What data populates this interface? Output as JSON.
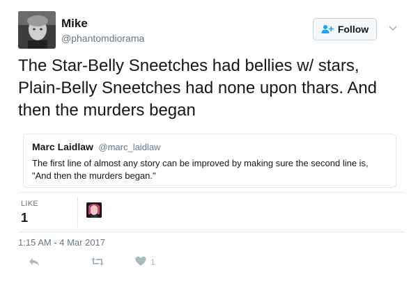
{
  "author": {
    "name": "Mike",
    "handle": "@phantomdiorama"
  },
  "follow_button": {
    "label": "Follow"
  },
  "tweet": {
    "lines": [
      "The Star-Belly Sneetches had bellies w/ stars,",
      "Plain-Belly Sneetches had none upon thars. And",
      "then the murders began"
    ]
  },
  "quoted_tweet": {
    "name": "Marc Laidlaw",
    "handle": "@marc_laidlaw",
    "lines": [
      "The first line of almost any story can be improved by making sure the second line is,",
      "\"And then the murders began.\""
    ]
  },
  "stats": {
    "likes_label": "LIKE",
    "likes_count": "1"
  },
  "timestamp": "1:15 AM - 4 Mar 2017",
  "actions": {
    "like_count": "1"
  },
  "colors": {
    "text": "#14171a",
    "muted": "#657786",
    "border": "#e1e8ed",
    "icon": "#aab8c2",
    "follow_icon": "#1da1f2"
  },
  "icons": [
    "follow-person-plus-icon",
    "chevron-down-icon",
    "reply-icon",
    "retweet-icon",
    "heart-icon"
  ]
}
